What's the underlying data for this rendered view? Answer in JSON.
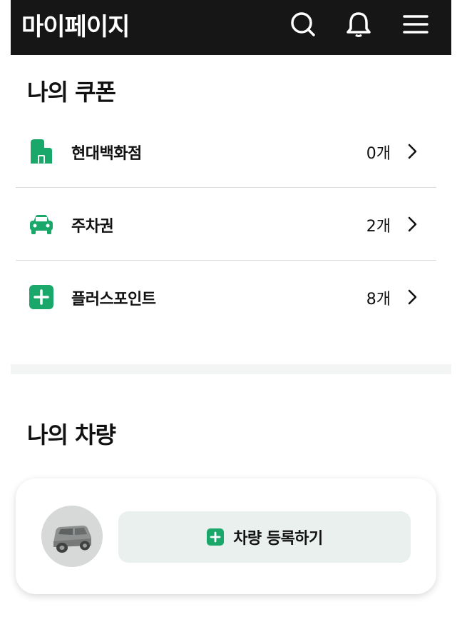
{
  "header": {
    "title": "마이페이지",
    "icons": [
      "search-icon",
      "bell-icon",
      "menu-icon"
    ]
  },
  "coupons": {
    "title": "나의 쿠폰",
    "items": [
      {
        "label": "현대백화점",
        "count": "0개",
        "icon": "store-icon"
      },
      {
        "label": "주차권",
        "count": "2개",
        "icon": "car-icon"
      },
      {
        "label": "플러스포인트",
        "count": "8개",
        "icon": "plus-square-icon"
      }
    ]
  },
  "vehicles": {
    "title": "나의 차량",
    "register_label": "차량 등록하기",
    "avatar_icon": "car-avatar-icon",
    "register_icon": "plus-square-icon"
  },
  "colors": {
    "header_bg": "#161616",
    "accent_green": "#1aa86a",
    "button_bg": "#eaf0ee",
    "divider": "#dcdcdc"
  }
}
